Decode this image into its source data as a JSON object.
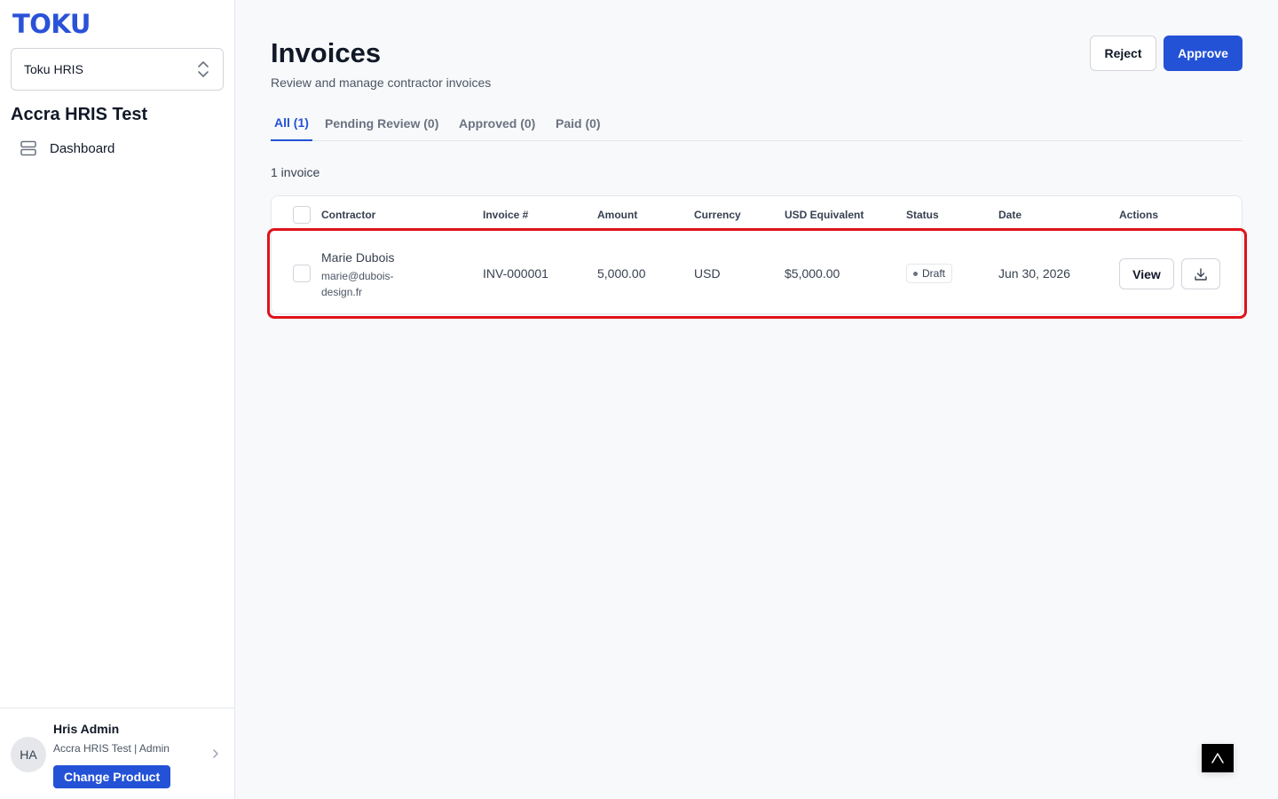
{
  "sidebar": {
    "logo": "TOKU",
    "product_select": {
      "value": "Toku HRIS"
    },
    "org_name": "Accra HRIS Test",
    "nav": [
      {
        "label": "Dashboard",
        "icon": "server-stack-icon"
      }
    ],
    "user": {
      "initials": "HA",
      "name": "Hris Admin",
      "meta": "Accra HRIS Test | Admin",
      "change_product_label": "Change Product"
    }
  },
  "header": {
    "title": "Invoices",
    "subtitle": "Review and manage contractor invoices",
    "reject_label": "Reject",
    "approve_label": "Approve"
  },
  "tabs": [
    {
      "label": "All (1)",
      "active": true
    },
    {
      "label": "Pending Review (0)",
      "active": false
    },
    {
      "label": "Approved (0)",
      "active": false
    },
    {
      "label": "Paid (0)",
      "active": false
    }
  ],
  "invoice_count": "1 invoice",
  "table": {
    "columns": [
      "Contractor",
      "Invoice #",
      "Amount",
      "Currency",
      "USD Equivalent",
      "Status",
      "Date",
      "Actions"
    ],
    "rows": [
      {
        "contractor_name": "Marie Dubois",
        "contractor_email": "marie@dubois-design.fr",
        "invoice_number": "INV-000001",
        "amount": "5,000.00",
        "currency": "USD",
        "usd_equivalent": "$5,000.00",
        "status": "Draft",
        "date": "Jun 30, 2026",
        "view_label": "View"
      }
    ]
  },
  "colors": {
    "brand": "#2a52d8",
    "primary_button": "#2452d6",
    "highlight": "#e0121a"
  }
}
